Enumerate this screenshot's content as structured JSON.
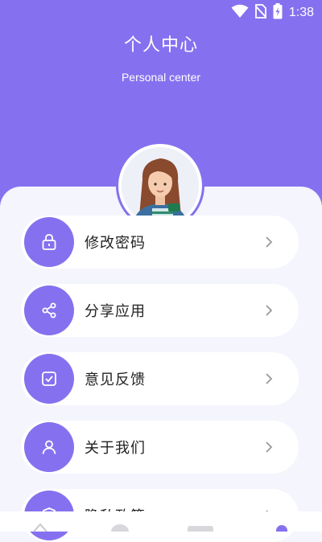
{
  "status_bar": {
    "time": "1:38",
    "icons": [
      "wifi-icon",
      "no-sim-icon",
      "battery-charging-icon"
    ]
  },
  "header": {
    "title": "个人中心",
    "subtitle": "Personal center",
    "color": "#8571ef"
  },
  "profile": {
    "avatar": "avatar-illustration"
  },
  "menu": [
    {
      "label": "修改密码",
      "icon": "lock-icon"
    },
    {
      "label": "分享应用",
      "icon": "share-icon"
    },
    {
      "label": "意见反馈",
      "icon": "feedback-icon"
    },
    {
      "label": "关于我们",
      "icon": "user-icon"
    },
    {
      "label": "隐私政策",
      "icon": "shield-icon"
    }
  ],
  "bottom_nav": {
    "tabs": [
      "tab-1",
      "tab-2",
      "tab-3",
      "tab-4"
    ]
  }
}
